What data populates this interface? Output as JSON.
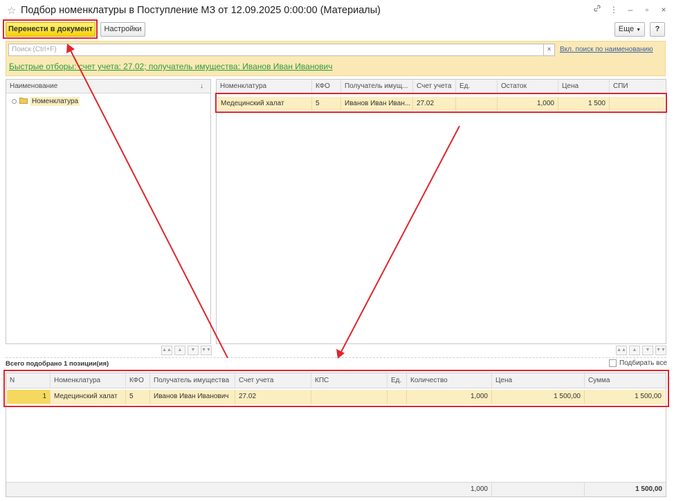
{
  "window": {
    "title": "Подбор номенклатуры в Поступление МЗ от 12.09.2025 0:00:00 (Материалы)"
  },
  "toolbar": {
    "transfer_label": "Перенести в документ",
    "settings_label": "Настройки",
    "more_label": "Еще",
    "help_label": "?"
  },
  "search": {
    "placeholder": "Поиск (Ctrl+F)",
    "clear_label": "×",
    "by_name_link": "Вкл. поиск по наименованию"
  },
  "quick_filters": {
    "text": "Быстрые отборы: счет учета: 27.02; получатель имущества: Иванов Иван Иванович"
  },
  "tree": {
    "header": "Наименование",
    "sort_icon": "↓",
    "root": "Номенклатура"
  },
  "items_grid": {
    "columns": [
      "Номенклатура",
      "КФО",
      "Получатель имущ...",
      "Счет учета",
      "Ед.",
      "Остаток",
      "Цена",
      "СПИ"
    ],
    "rows": [
      {
        "name": "Медецинский халат",
        "kfo": "5",
        "recipient": "Иванов Иван Иван...",
        "account": "27.02",
        "unit": "",
        "balance": "1,000",
        "price": "1 500",
        "spi": ""
      }
    ]
  },
  "selected": {
    "total_label": "Всего подобрано 1 позиции(ия)",
    "select_all_label": "Подбирать все",
    "columns": [
      "N",
      "Номенклатура",
      "КФО",
      "Получатель имущества",
      "Счет учета",
      "КПС",
      "Ед.",
      "Количество",
      "Цена",
      "Сумма"
    ],
    "rows": [
      {
        "n": "1",
        "name": "Медецинский халат",
        "kfo": "5",
        "recipient": "Иванов Иван Иванович",
        "account": "27.02",
        "kps": "",
        "unit": "",
        "quantity": "1,000",
        "price": "1 500,00",
        "sum": "1 500,00"
      }
    ],
    "footer": {
      "quantity": "1,000",
      "sum": "1 500,00"
    }
  },
  "colors": {
    "accent_yellow": "#f2d300",
    "selected_row": "#fbeec0",
    "filter_panel": "#fbe9b5",
    "quick_filter_link": "#2e9a3b",
    "annotation_red": "#e0252a"
  }
}
